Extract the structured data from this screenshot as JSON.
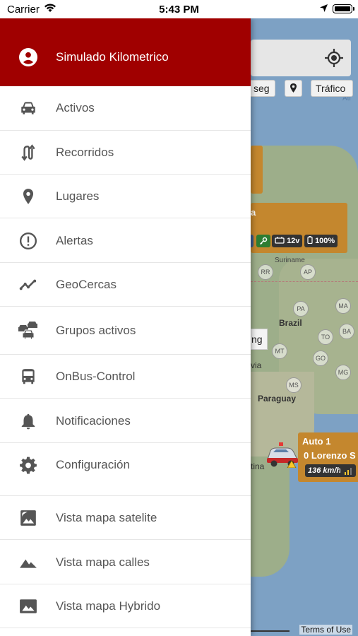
{
  "status_bar": {
    "carrier": "Carrier",
    "time": "5:43 PM"
  },
  "drawer": {
    "header": {
      "icon": "account-circle-icon",
      "title": "Simulado Kilometrico",
      "background_color": "#a00000"
    },
    "items": [
      {
        "label": "Activos",
        "icon": "car-icon"
      },
      {
        "label": "Recorridos",
        "icon": "routes-icon"
      },
      {
        "label": "Lugares",
        "icon": "location-pin-icon"
      },
      {
        "label": "Alertas",
        "icon": "alert-circle-icon"
      },
      {
        "label": "GeoCercas",
        "icon": "chart-line-icon"
      },
      {
        "label": "Grupos activos",
        "icon": "car-group-icon"
      },
      {
        "label": "OnBus-Control",
        "icon": "bus-icon"
      },
      {
        "label": "Notificaciones",
        "icon": "bell-icon"
      },
      {
        "label": "Configuración",
        "icon": "gear-icon"
      }
    ],
    "map_views": [
      {
        "label": "Vista mapa satelite",
        "icon": "satellite-image-icon"
      },
      {
        "label": "Vista mapa calles",
        "icon": "mountains-icon"
      },
      {
        "label": "Vista mapa Hybrido",
        "icon": "landscape-image-icon"
      }
    ]
  },
  "map": {
    "chips": {
      "seg": "seg",
      "traffic": "Tráfico"
    },
    "labels": {
      "suriname": "Suriname",
      "brazil": "Brazil",
      "paraguay": "Paraguay",
      "bolivia_fragment": "via",
      "argentina_fragment": "tina",
      "atlantic_fragment": "Atl",
      "card_fragment": "a",
      "search_fragment": "ng"
    },
    "states": [
      "RR",
      "AP",
      "PA",
      "MA",
      "TO",
      "GO",
      "MT",
      "MS",
      "MG",
      "BA"
    ],
    "vehicle_card": {
      "battery_label": "12v",
      "percent_label": "100%"
    },
    "auto_card": {
      "title": "Auto 1",
      "subtitle": "0 Lorenzo S",
      "speed": "136 km/h"
    },
    "terms": "Terms of Use"
  }
}
